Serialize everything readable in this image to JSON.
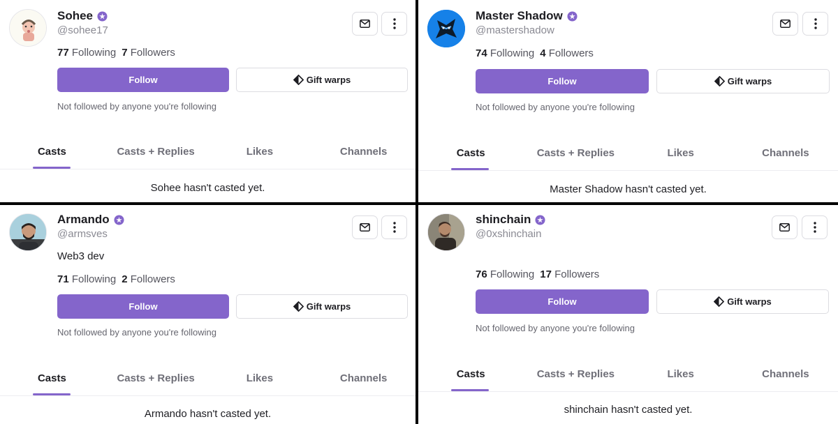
{
  "accent_color": "#8465cb",
  "icons": {
    "verified": "verified-badge-icon",
    "message": "mail-icon",
    "more": "more-vertical-icon",
    "gift": "warp-diamond-icon"
  },
  "profiles": [
    {
      "name": "Sohee",
      "handle": "@sohee17",
      "bio": "",
      "following_count": "77",
      "following_label": "Following",
      "followers_count": "7",
      "followers_label": "Followers",
      "follow_label": "Follow",
      "gift_label": "Gift warps",
      "mutual_text": "Not followed by anyone you're following",
      "tabs": [
        "Casts",
        "Casts + Replies",
        "Likes",
        "Channels"
      ],
      "active_tab": "Casts",
      "empty_text": "Sohee hasn't casted yet."
    },
    {
      "name": "Master Shadow",
      "handle": "@mastershadow",
      "bio": "",
      "following_count": "74",
      "following_label": "Following",
      "followers_count": "4",
      "followers_label": "Followers",
      "follow_label": "Follow",
      "gift_label": "Gift warps",
      "mutual_text": "Not followed by anyone you're following",
      "tabs": [
        "Casts",
        "Casts + Replies",
        "Likes",
        "Channels"
      ],
      "active_tab": "Casts",
      "empty_text": "Master Shadow hasn't casted yet."
    },
    {
      "name": "Armando",
      "handle": "@armsves",
      "bio": "Web3 dev",
      "following_count": "71",
      "following_label": "Following",
      "followers_count": "2",
      "followers_label": "Followers",
      "follow_label": "Follow",
      "gift_label": "Gift warps",
      "mutual_text": "Not followed by anyone you're following",
      "tabs": [
        "Casts",
        "Casts + Replies",
        "Likes",
        "Channels"
      ],
      "active_tab": "Casts",
      "empty_text": "Armando hasn't casted yet."
    },
    {
      "name": "shinchain",
      "handle": "@0xshinchain",
      "bio": "",
      "following_count": "76",
      "following_label": "Following",
      "followers_count": "17",
      "followers_label": "Followers",
      "follow_label": "Follow",
      "gift_label": "Gift warps",
      "mutual_text": "Not followed by anyone you're following",
      "tabs": [
        "Casts",
        "Casts + Replies",
        "Likes",
        "Channels"
      ],
      "active_tab": "Casts",
      "empty_text": "shinchain hasn't casted yet."
    }
  ]
}
